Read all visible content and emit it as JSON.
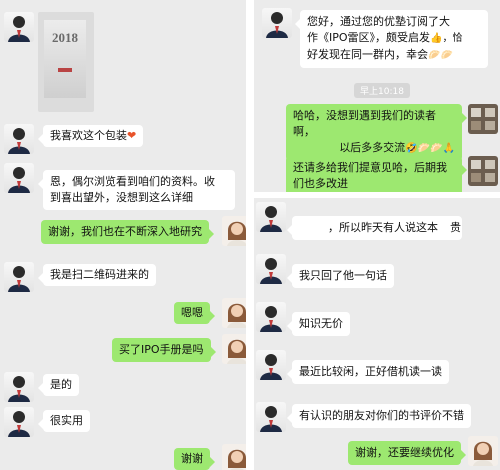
{
  "left_panel": {
    "photo": {
      "cover_year": "2018"
    },
    "messages": [
      {
        "side": "in",
        "text": "我喜欢这个包装",
        "emoji": "❤"
      },
      {
        "side": "in",
        "lines": [
          "恩，偶尔浏览看到咱们的资料。收",
          "到喜出望外，没想到这么详细"
        ]
      },
      {
        "side": "out",
        "text": "谢谢，我们也在不断深入地研究"
      },
      {
        "side": "in",
        "text": "我是扫二维码进来的"
      },
      {
        "side": "out",
        "text": "嗯嗯"
      },
      {
        "side": "out",
        "text": "买了IPO手册是吗"
      },
      {
        "side": "in",
        "text": "是的"
      },
      {
        "side": "in",
        "text": "很实用"
      },
      {
        "side": "out",
        "text": "谢谢"
      }
    ]
  },
  "right_panel": {
    "first_message": {
      "lines": [
        "您好，通过您的优塾订阅了大",
        "作《IPO雷区》，颇受启发",
        "好发现在同一群内，幸会"
      ],
      "emoji_1": "👍，恰",
      "emoji_2": "🥟🥟"
    },
    "timestamp": "早上10:18",
    "reply_1": {
      "lines": [
        "哈哈，没想到遇到我们的读者啊，",
        "以后多多交流"
      ],
      "emoji": "🤣🥟🥟🙏"
    },
    "reply_2": {
      "lines": [
        "还请多给我们提意见哈，后期我",
        "们也多改进"
      ]
    }
  },
  "right_lower_panel": {
    "messages": [
      {
        "side": "in",
        "text": "，所以昨天有人说这本",
        "tail": "贵"
      },
      {
        "side": "in",
        "text": "我只回了他一句话"
      },
      {
        "side": "in",
        "text": "知识无价"
      },
      {
        "side": "in",
        "text": "最近比较闲，正好借机读一读"
      },
      {
        "side": "in",
        "text": "有认识的朋友对你们的书评价不错"
      },
      {
        "side": "out",
        "text": "谢谢，还要继续优化"
      }
    ]
  },
  "colors": {
    "panel_bg": "#ebebeb",
    "bubble_out": "#9de870",
    "bubble_in": "#ffffff"
  }
}
